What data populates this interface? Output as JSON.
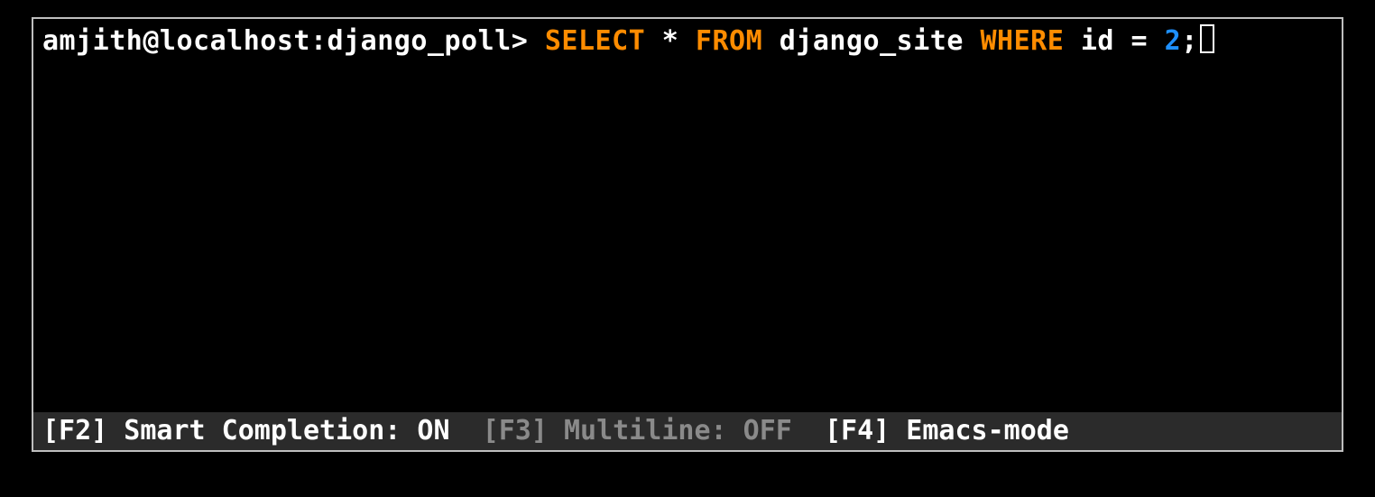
{
  "prompt": "amjith@localhost:django_poll> ",
  "sql": {
    "tokens": [
      {
        "text": "SELECT",
        "cls": "kw"
      },
      {
        "text": " ",
        "cls": "ident"
      },
      {
        "text": "*",
        "cls": "star"
      },
      {
        "text": " ",
        "cls": "ident"
      },
      {
        "text": "FROM",
        "cls": "kw"
      },
      {
        "text": " ",
        "cls": "ident"
      },
      {
        "text": "django_site",
        "cls": "ident"
      },
      {
        "text": " ",
        "cls": "ident"
      },
      {
        "text": "WHERE",
        "cls": "kw"
      },
      {
        "text": " ",
        "cls": "ident"
      },
      {
        "text": "id",
        "cls": "ident"
      },
      {
        "text": " ",
        "cls": "ident"
      },
      {
        "text": "=",
        "cls": "punct"
      },
      {
        "text": " ",
        "cls": "ident"
      },
      {
        "text": "2",
        "cls": "num"
      },
      {
        "text": ";",
        "cls": "punct"
      }
    ]
  },
  "status": {
    "smart_key": "[F2]",
    "smart_label": " Smart Completion: ON  ",
    "multi_key": "[F3]",
    "multi_label": " Multiline: OFF  ",
    "mode_key": "[F4]",
    "mode_label": " Emacs-mode"
  }
}
